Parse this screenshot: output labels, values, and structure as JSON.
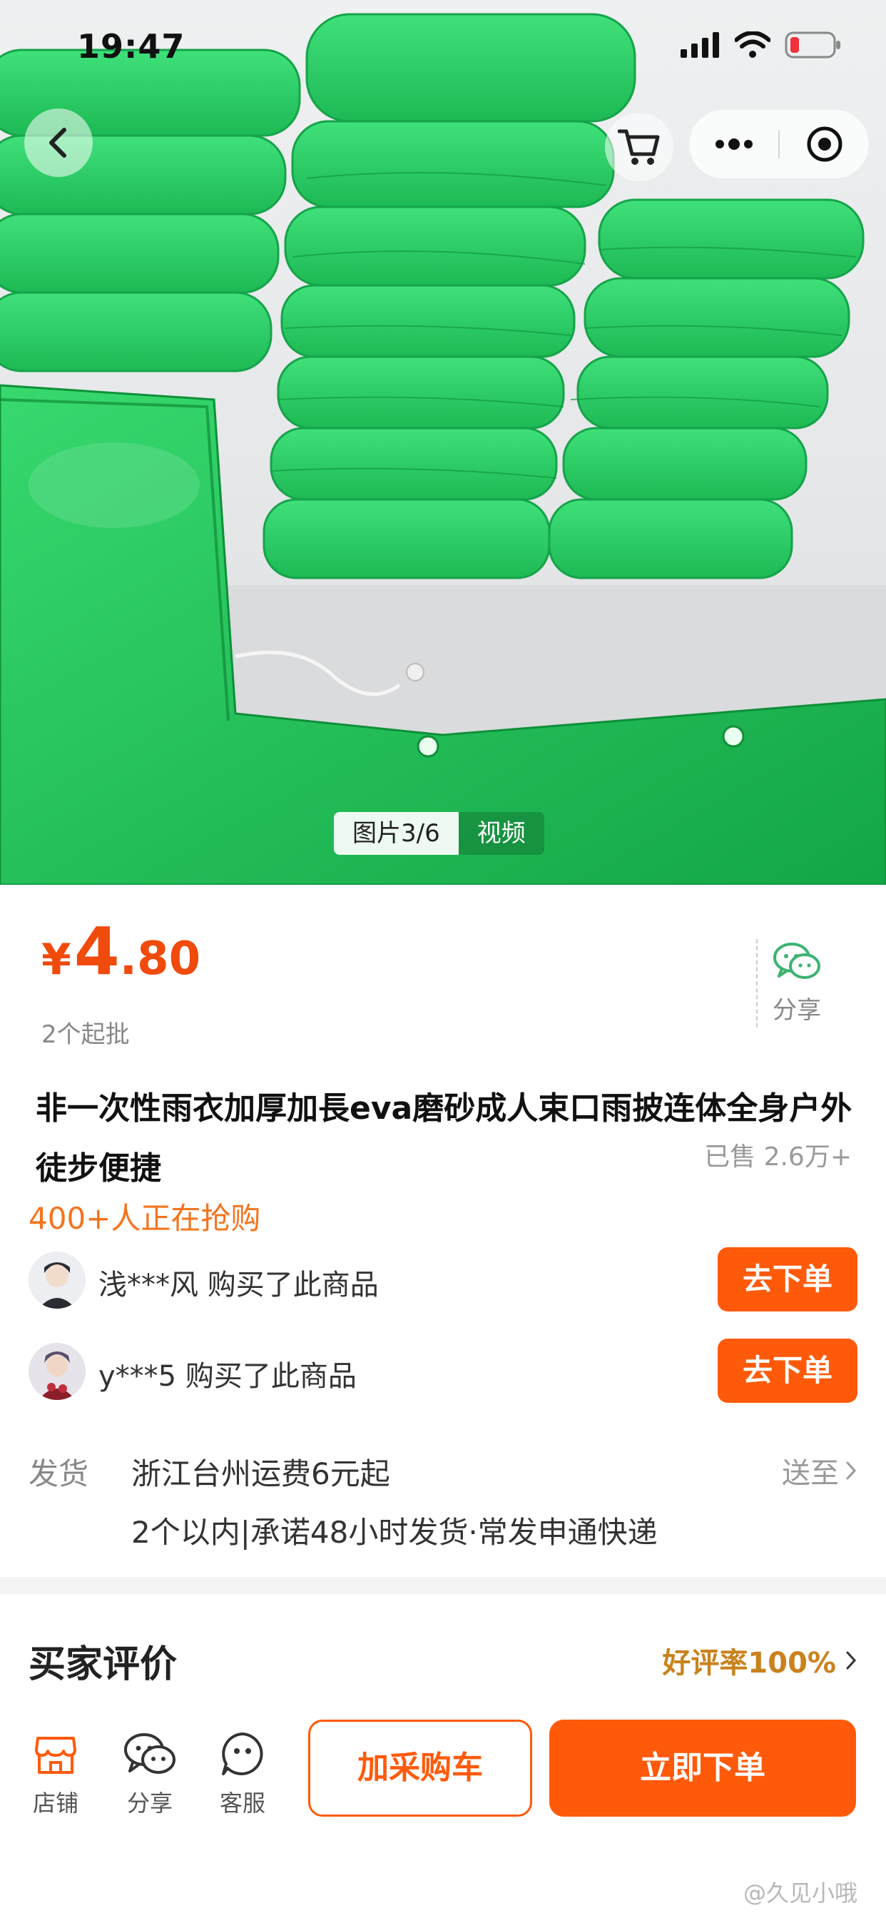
{
  "status_bar": {
    "time": "19:47"
  },
  "gallery": {
    "tabs": [
      {
        "label": "图片3/6",
        "active": true
      },
      {
        "label": "视频",
        "active": false
      }
    ],
    "product_color": "#22c55e"
  },
  "product": {
    "price_symbol": "¥",
    "price_integer": "4",
    "price_decimal": ".80",
    "min_order": "2个起批",
    "share_label": "分享",
    "title": "非一次性雨衣加厚加長eva磨砂成人束口雨披连体全身户外徒步便捷",
    "sold": "已售 2.6万+"
  },
  "buying_now": "400+人正在抢购",
  "recent_buyers": [
    {
      "text": "浅***风 购买了此商品",
      "button": "去下单"
    },
    {
      "text": "y***5 购买了此商品",
      "button": "去下单"
    }
  ],
  "shipping": {
    "label": "发货",
    "from": "浙江台州运费6元起",
    "to_label": "送至",
    "promise": "2个以内|承诺48小时发货·常发申通快递"
  },
  "reviews": {
    "title": "买家评价",
    "rating": "好评率100%"
  },
  "bottom_bar": {
    "store_label": "店铺",
    "share_label": "分享",
    "service_label": "客服",
    "add_cart_label": "加采购车",
    "buy_now_label": "立即下单"
  },
  "watermark": "@久见小哦",
  "colors": {
    "accent": "#ff5a0a",
    "price": "#f04a0c",
    "highlight": "#f5731e",
    "rating": "#c9821c"
  }
}
